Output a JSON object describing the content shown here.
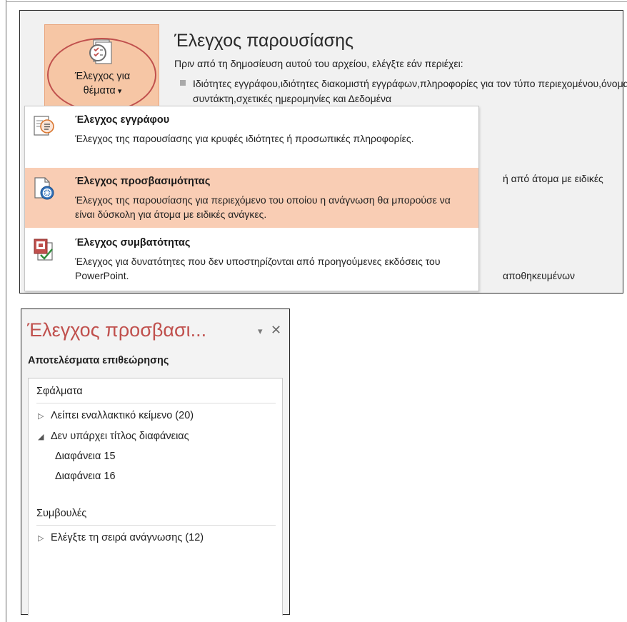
{
  "info_panel": {
    "check_issues_button": {
      "line1": "Έλεγχος για",
      "line2": "θέματα"
    },
    "inspect_title": "Έλεγχος παρουσίασης",
    "inspect_intro": "Πριν από τη δημοσίευση αυτού του αρχείου, ελέγξτε εάν περιέχει:",
    "inspect_detail": "Ιδιότητες εγγράφου,ιδιότητες διακομιστή εγγράφων,πληροφορίες για τον τύπο περιεχομένου,όνομα συντάκτη,σχετικές ημερομηνίες και Δεδομένα",
    "peek_accessibility": "ή από άτομα με ειδικές",
    "peek_compatibility": "αποθηκευμένων"
  },
  "dropdown": {
    "items": [
      {
        "title": "Έλεγχος εγγράφου",
        "description": "Έλεγχος της παρουσίασης για κρυφές ιδιότητες ή προσωπικές πληροφορίες.",
        "icon": "inspect-document-icon"
      },
      {
        "title": "Έλεγχος προσβασιμότητας",
        "description": "Έλεγχος της παρουσίασης για περιεχόμενο του οποίου η ανάγνωση θα μπορούσε να είναι δύσκολη για άτομα με ειδικές ανάγκες.",
        "icon": "accessibility-icon"
      },
      {
        "title": "Έλεγχος συμβατότητας",
        "description": "Έλεγχος για δυνατότητες που δεν υποστηρίζονται από προηγούμενες εκδόσεις του PowerPoint.",
        "icon": "compatibility-icon"
      }
    ]
  },
  "task_pane": {
    "title": "Έλεγχος προσβασι...",
    "options_glyph": "▾",
    "close_glyph": "✕",
    "subtitle": "Αποτελέσματα επιθεώρησης",
    "errors_header": "Σφάλματα",
    "errors": [
      {
        "label": "Λείπει εναλλακτικό κείμενο (20)",
        "glyph": "▷",
        "expanded": false
      },
      {
        "label": "Δεν υπάρχει τίτλος διαφάνειας",
        "glyph": "◢",
        "expanded": true,
        "children": [
          "Διαφάνεια 15",
          "Διαφάνεια 16"
        ]
      }
    ],
    "tips_header": "Συμβουλές",
    "tips": [
      {
        "label": "Ελέγξτε τη σειρά ανάγνωσης (12)",
        "glyph": "▷",
        "expanded": false
      }
    ]
  },
  "colors": {
    "accent": "#c0504d",
    "highlight": "#f9cdb4",
    "button_bg": "#f6c6a5"
  }
}
